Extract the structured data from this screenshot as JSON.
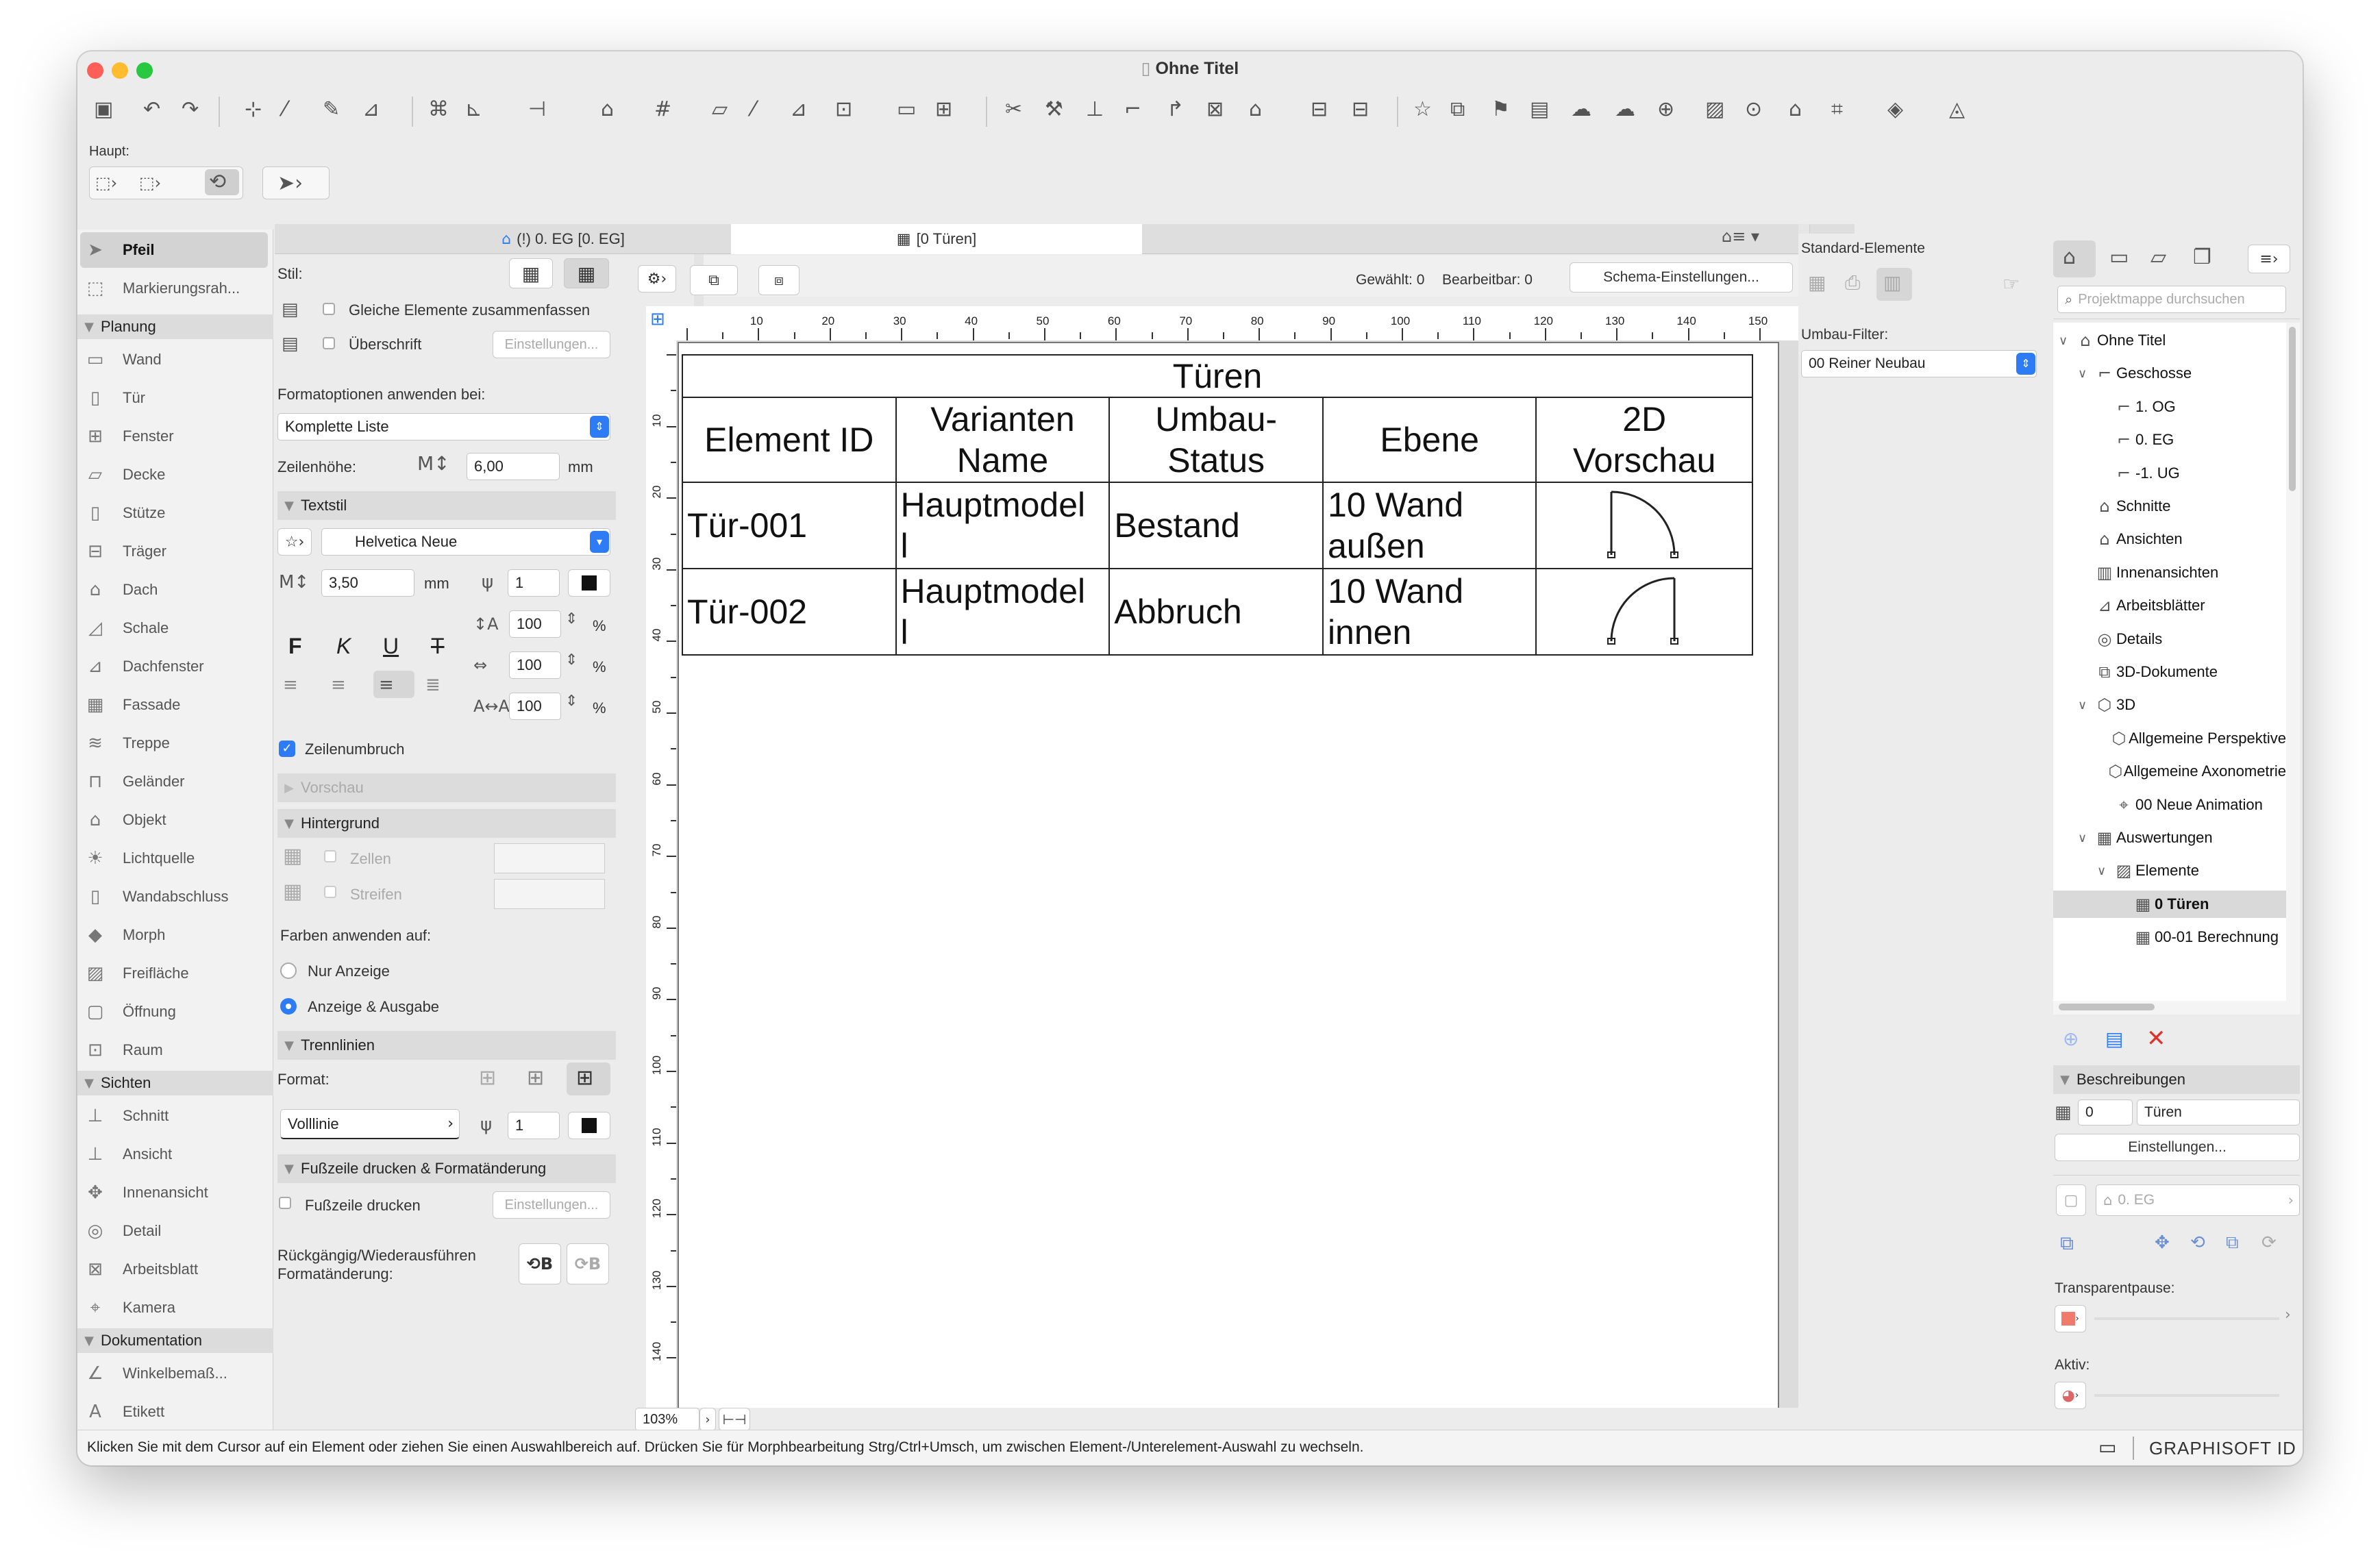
{
  "window": {
    "title": "Ohne Titel"
  },
  "toolbar": {
    "label": "Haupt:"
  },
  "status_bar": {
    "text": "Klicken Sie mit dem Cursor auf ein Element oder ziehen Sie einen Auswahlbereich auf. Drücken Sie für Morphbearbeitung Strg/Ctrl+Umsch, um zwischen Element-/Unterelement-Auswahl zu wechseln.",
    "brand": "GRAPHISOFT ID"
  },
  "toolbox": {
    "top_items": [
      {
        "label": "Pfeil",
        "icon": "arrow-icon"
      },
      {
        "label": "Markierungsrah...",
        "icon": "marquee-icon"
      }
    ],
    "sections": [
      {
        "title": "Planung",
        "items": [
          "Wand",
          "Tür",
          "Fenster",
          "Decke",
          "Stütze",
          "Träger",
          "Dach",
          "Schale",
          "Dachfenster",
          "Fassade",
          "Treppe",
          "Geländer",
          "Objekt",
          "Lichtquelle",
          "Wandabschluss",
          "Morph",
          "Freifläche",
          "Öffnung",
          "Raum"
        ]
      },
      {
        "title": "Sichten",
        "items": [
          "Schnitt",
          "Ansicht",
          "Innenansicht",
          "Detail",
          "Arbeitsblatt",
          "Kamera"
        ]
      },
      {
        "title": "Dokumentation",
        "items": [
          "Winkelbemaß...",
          "Etikett"
        ]
      }
    ]
  },
  "tabs": [
    {
      "label": "(!) 0. EG [0. EG]"
    },
    {
      "label": "[0 Türen]"
    }
  ],
  "format_panel": {
    "stil_label": "Stil:",
    "merge_label": "Gleiche Elemente zusammenfassen",
    "header_label": "Überschrift",
    "einstellungen": "Einstellungen...",
    "apply_label": "Formatoptionen anwenden bei:",
    "apply_value": "Komplette Liste",
    "row_height_label": "Zeilenhöhe:",
    "row_height_value": "6,00",
    "unit_mm": "mm",
    "textstil": "Textstil",
    "font": "Helvetica Neue",
    "font_size": "3,50",
    "pen": "1",
    "bold": "F",
    "italic": "K",
    "underline": "U",
    "strike": "T",
    "spacing1": "100",
    "spacing2": "100",
    "spacing3": "100",
    "percent": "%",
    "wrap_label": "Zeilenumbruch",
    "vorschau": "Vorschau",
    "hintergrund": "Hintergrund",
    "zellen": "Zellen",
    "streifen": "Streifen",
    "colors_label": "Farben anwenden auf:",
    "radio1": "Nur Anzeige",
    "radio2": "Anzeige & Ausgabe",
    "trennlinien": "Trennlinien",
    "format_label": "Format:",
    "line_type": "Volllinie",
    "line_pen": "1",
    "footer_section": "Fußzeile drucken & Formatänderung",
    "footer_label": "Fußzeile drucken",
    "undo_label": "Rückgängig/Wiederausführen Formatänderung:"
  },
  "schedule_toolbar": {
    "selected": "Gewählt: 0",
    "editable": "Bearbeitbar: 0",
    "schema_button": "Schema-Einstellungen..."
  },
  "ruler": {
    "h": [
      "10",
      "20",
      "30",
      "40",
      "50",
      "60",
      "70",
      "80",
      "90",
      "100",
      "110",
      "120",
      "130",
      "140",
      "150"
    ],
    "v": [
      "10",
      "20",
      "30",
      "40",
      "50",
      "60",
      "70",
      "80",
      "90",
      "100",
      "110",
      "120",
      "130",
      "140"
    ]
  },
  "schedule": {
    "title": "Türen",
    "headers": [
      [
        "Element ID"
      ],
      [
        "Varianten",
        "Name"
      ],
      [
        "Umbau-",
        "Status"
      ],
      [
        "Ebene"
      ],
      [
        "2D",
        "Vorschau"
      ]
    ],
    "rows": [
      {
        "id": "Tür-001",
        "name": [
          "Hauptmodel",
          "l"
        ],
        "status": "Bestand",
        "level": [
          "10 Wand",
          "außen"
        ]
      },
      {
        "id": "Tür-002",
        "name": [
          "Hauptmodel",
          "l"
        ],
        "status": "Abbruch",
        "level": [
          "10 Wand",
          "innen"
        ]
      }
    ]
  },
  "zoom": "103%",
  "renovation": {
    "std_label": "Standard-Elemente",
    "filter_label": "Umbau-Filter:",
    "filter_value": "00 Reiner Neubau"
  },
  "navigator": {
    "search_placeholder": "Projektmappe durchsuchen",
    "tree": [
      {
        "label": "Ohne Titel",
        "indent": 0,
        "icon": "house-icon",
        "chev": "∨"
      },
      {
        "label": "Geschosse",
        "indent": 1,
        "icon": "story-icon",
        "chev": "∨"
      },
      {
        "label": "1. OG",
        "indent": 2,
        "icon": "story-icon",
        "chev": ""
      },
      {
        "label": "0. EG",
        "indent": 2,
        "icon": "story-icon",
        "chev": ""
      },
      {
        "label": "-1. UG",
        "indent": 2,
        "icon": "story-icon",
        "chev": ""
      },
      {
        "label": "Schnitte",
        "indent": 1,
        "icon": "section-icon",
        "chev": ""
      },
      {
        "label": "Ansichten",
        "indent": 1,
        "icon": "elevation-icon",
        "chev": ""
      },
      {
        "label": "Innenansichten",
        "indent": 1,
        "icon": "interior-icon",
        "chev": ""
      },
      {
        "label": "Arbeitsblätter",
        "indent": 1,
        "icon": "worksheet-icon",
        "chev": ""
      },
      {
        "label": "Details",
        "indent": 1,
        "icon": "detail-icon",
        "chev": ""
      },
      {
        "label": "3D-Dokumente",
        "indent": 1,
        "icon": "doc3d-icon",
        "chev": ""
      },
      {
        "label": "3D",
        "indent": 1,
        "icon": "cube-icon",
        "chev": "∨"
      },
      {
        "label": "Allgemeine Perspektive",
        "indent": 2,
        "icon": "cube-icon",
        "chev": ""
      },
      {
        "label": "Allgemeine Axonometrie",
        "indent": 2,
        "icon": "cube-icon",
        "chev": ""
      },
      {
        "label": "00 Neue Animation",
        "indent": 2,
        "icon": "camera-icon",
        "chev": ""
      },
      {
        "label": "Auswertungen",
        "indent": 1,
        "icon": "table-icon",
        "chev": "∨"
      },
      {
        "label": "Elemente",
        "indent": 2,
        "icon": "hatch-icon",
        "chev": "∨"
      },
      {
        "label": "0 Türen",
        "indent": 3,
        "icon": "table-icon",
        "chev": "",
        "selected": true
      },
      {
        "label": "00-01 Berechnung",
        "indent": 3,
        "icon": "table-icon",
        "chev": ""
      }
    ],
    "beschreibungen": "Beschreibungen",
    "desc_id": "0",
    "desc_name": "Türen",
    "settings": "Einstellungen...",
    "story": "0. EG",
    "trace_label": "Transparentpause:",
    "active_label": "Aktiv:"
  },
  "colors": {
    "accent": "#2d7cf6",
    "delete": "#e0322c",
    "window_bg": "#ececec"
  }
}
